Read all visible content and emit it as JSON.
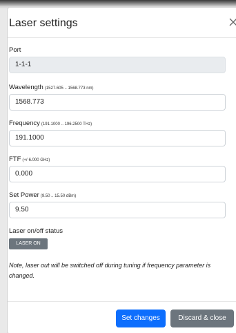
{
  "modal": {
    "title": "Laser settings"
  },
  "fields": {
    "port": {
      "label": "Port",
      "value": "1-1-1"
    },
    "wavelength": {
      "label": "Wavelength",
      "hint": "(1527.605 .. 1568.773 nm)",
      "value": "1568.773"
    },
    "frequency": {
      "label": "Frequency",
      "hint": "(191.1000 .. 196.2500 THz)",
      "value": "191.1000"
    },
    "ftf": {
      "label": "FTF",
      "hint": "(+/-6.000 GHz)",
      "value": "0.000"
    },
    "power": {
      "label": "Set Power",
      "hint": "(9.50 .. 15.50 dBm)",
      "value": "9.50"
    }
  },
  "laser": {
    "status_label": "Laser on/off status",
    "badge": "LASER ON"
  },
  "note": "Note, laser out will be switched off during tuning if frequency parameter is changed.",
  "footer": {
    "set_label": "Set changes",
    "discard_label": "Discard & close"
  },
  "colors": {
    "primary": "#0d6efd",
    "secondary": "#6c757d",
    "readonly_bg": "#e9ecef"
  },
  "icons": {
    "close": "close-icon"
  }
}
